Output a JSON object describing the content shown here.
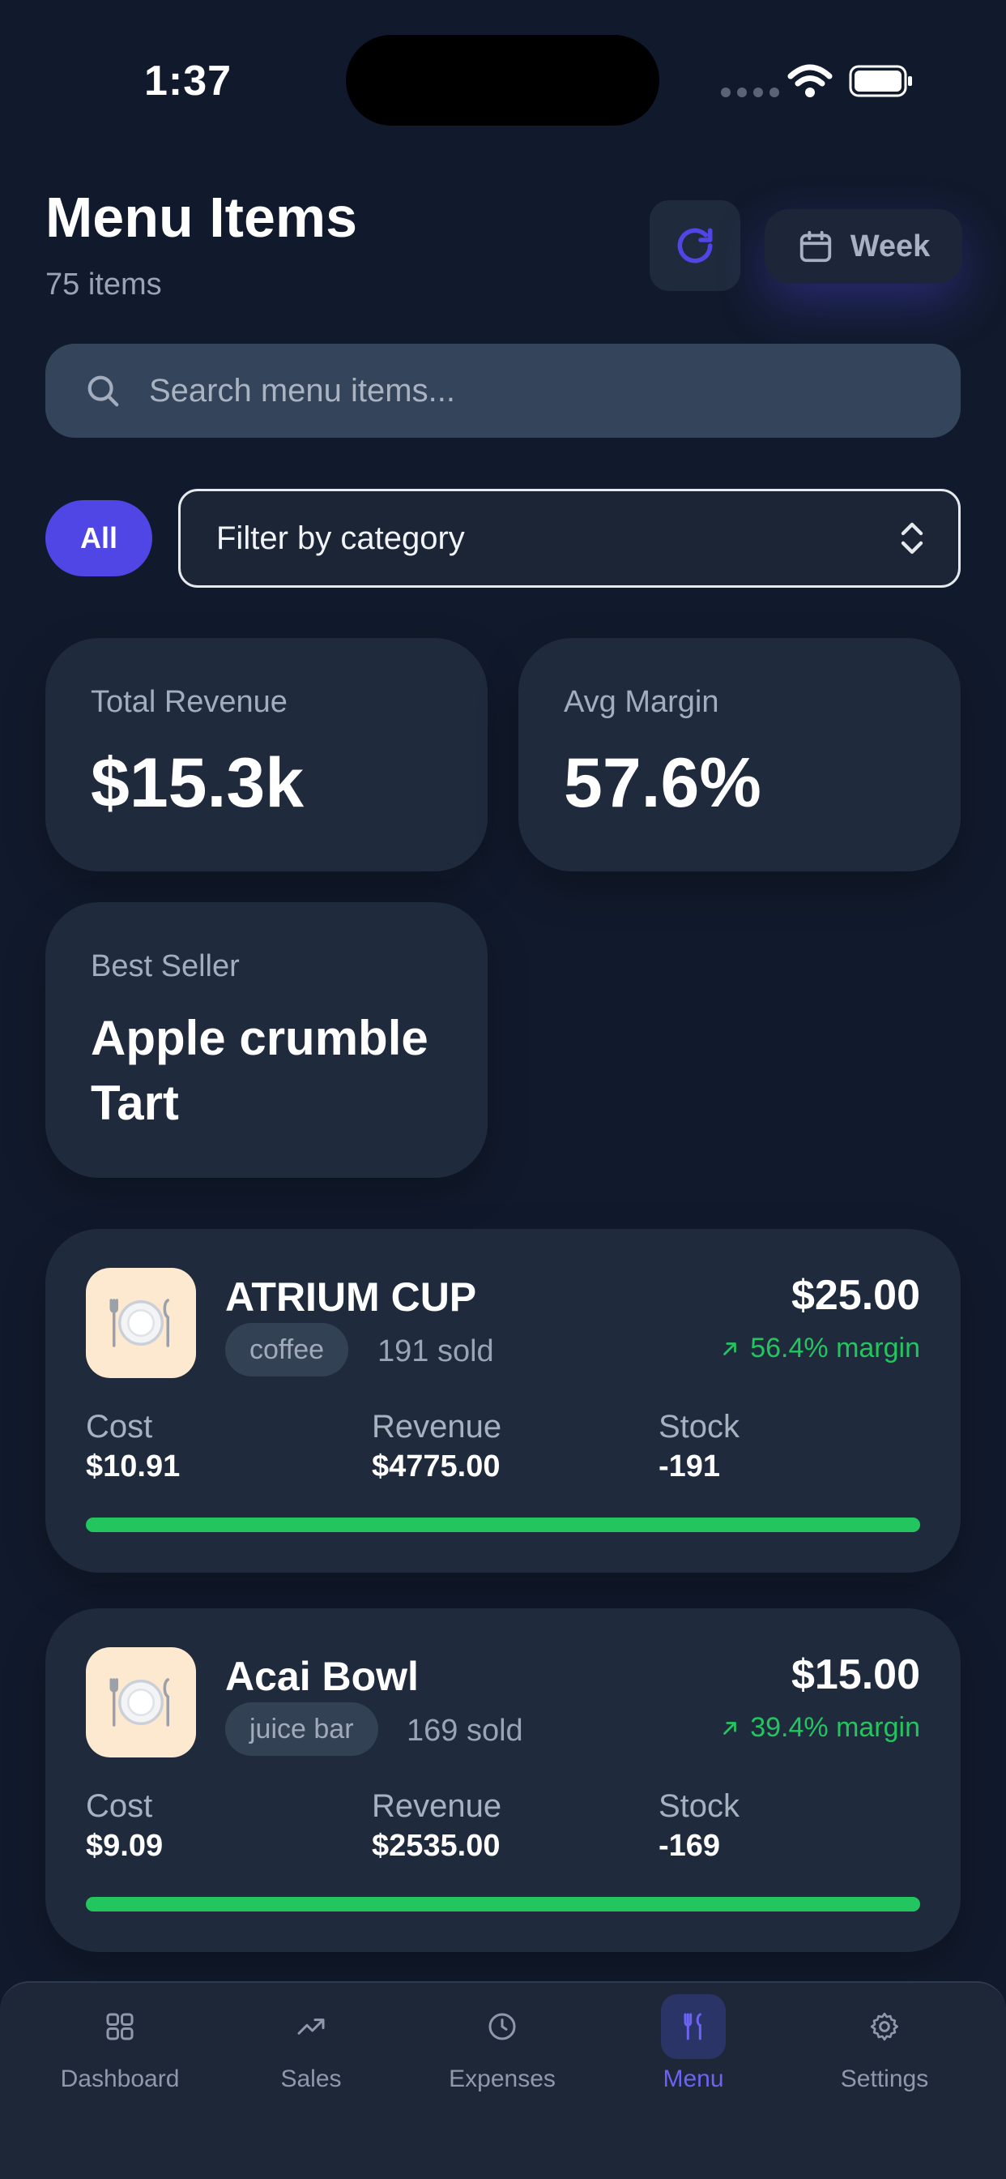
{
  "status_bar": {
    "time": "1:37"
  },
  "header": {
    "title": "Menu Items",
    "item_count": "75 items",
    "period_label": "Week"
  },
  "search": {
    "placeholder": "Search menu items..."
  },
  "filters": {
    "all_label": "All",
    "category_select": "Filter by category"
  },
  "stats": {
    "total_revenue": {
      "label": "Total Revenue",
      "value": "$15.3k"
    },
    "avg_margin": {
      "label": "Avg Margin",
      "value": "57.6%"
    },
    "best_seller": {
      "label": "Best Seller",
      "value": "Apple crumble Tart"
    }
  },
  "items": [
    {
      "name": "ATRIUM CUP",
      "category": "coffee",
      "sold": "191 sold",
      "price": "$25.00",
      "margin": "56.4% margin",
      "cost_label": "Cost",
      "cost": "$10.91",
      "revenue_label": "Revenue",
      "revenue": "$4775.00",
      "stock_label": "Stock",
      "stock": "-191",
      "bar_fill_percent": 100
    },
    {
      "name": "Acai Bowl",
      "category": "juice bar",
      "sold": "169 sold",
      "price": "$15.00",
      "margin": "39.4% margin",
      "cost_label": "Cost",
      "cost": "$9.09",
      "revenue_label": "Revenue",
      "revenue": "$2535.00",
      "stock_label": "Stock",
      "stock": "-169",
      "bar_fill_percent": 100
    }
  ],
  "nav": {
    "items": [
      {
        "label": "Dashboard",
        "icon": "grid-icon"
      },
      {
        "label": "Sales",
        "icon": "trend-icon"
      },
      {
        "label": "Expenses",
        "icon": "clock-icon"
      },
      {
        "label": "Menu",
        "icon": "utensils-icon",
        "active": true
      },
      {
        "label": "Settings",
        "icon": "gear-icon"
      }
    ]
  },
  "colors": {
    "accent": "#4f46e5",
    "success": "#22c55e",
    "background": "#111a2c",
    "card": "#1f2a3d"
  }
}
